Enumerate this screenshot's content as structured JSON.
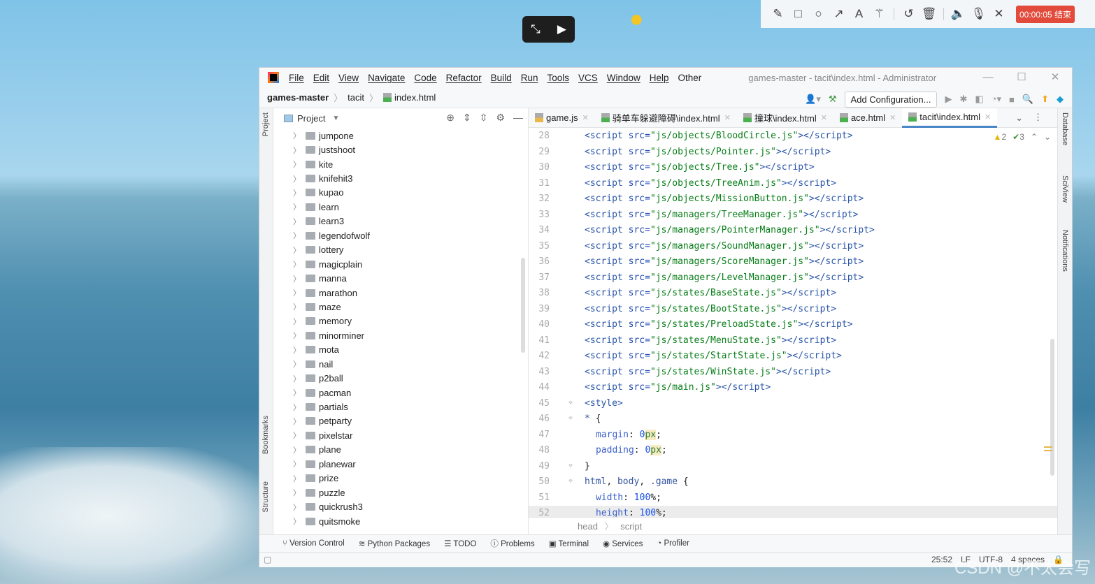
{
  "recorder": {
    "time": "00:00:05 结束",
    "tools": [
      "pencil",
      "rectangle",
      "circle",
      "arrow",
      "text",
      "magic-wand",
      "undo",
      "delete",
      "speaker",
      "microphone",
      "close"
    ]
  },
  "window": {
    "title": "games-master - tacit\\index.html - Administrator",
    "menu": [
      "File",
      "Edit",
      "View",
      "Navigate",
      "Code",
      "Refactor",
      "Build",
      "Run",
      "Tools",
      "VCS",
      "Window",
      "Help",
      "Other"
    ]
  },
  "breadcrumb": {
    "project": "games-master",
    "folder": "tacit",
    "file": "index.html"
  },
  "toolbar": {
    "add_config": "Add Configuration..."
  },
  "left_strip": {
    "project": "Project",
    "bookmarks": "Bookmarks",
    "structure": "Structure"
  },
  "right_strip": {
    "database": "Database",
    "sciview": "SciView",
    "notifications": "Notifications"
  },
  "project": {
    "title": "Project",
    "items": [
      "jumpone",
      "justshoot",
      "kite",
      "knifehit3",
      "kupao",
      "learn",
      "learn3",
      "legendofwolf",
      "lottery",
      "magicplain",
      "manna",
      "marathon",
      "maze",
      "memory",
      "minorminer",
      "mota",
      "nail",
      "p2ball",
      "pacman",
      "partials",
      "petparty",
      "pixelstar",
      "plane",
      "planewar",
      "prize",
      "puzzle",
      "quickrush3",
      "quitsmoke"
    ]
  },
  "tabs": [
    {
      "label": "game.js",
      "type": "js"
    },
    {
      "label": "骑单车躲避障碍\\index.html",
      "type": "html"
    },
    {
      "label": "撞球\\index.html",
      "type": "html"
    },
    {
      "label": "ace.html",
      "type": "html"
    },
    {
      "label": "tacit\\index.html",
      "type": "html",
      "active": true
    }
  ],
  "inspections": {
    "warnings": "2",
    "weak": "3"
  },
  "code": [
    {
      "n": "28",
      "src": "js/objects/BloodCircle.js"
    },
    {
      "n": "29",
      "src": "js/objects/Pointer.js"
    },
    {
      "n": "30",
      "src": "js/objects/Tree.js"
    },
    {
      "n": "31",
      "src": "js/objects/TreeAnim.js"
    },
    {
      "n": "32",
      "src": "js/objects/MissionButton.js"
    },
    {
      "n": "33",
      "src": "js/managers/TreeManager.js"
    },
    {
      "n": "34",
      "src": "js/managers/PointerManager.js"
    },
    {
      "n": "35",
      "src": "js/managers/SoundManager.js"
    },
    {
      "n": "36",
      "src": "js/managers/ScoreManager.js"
    },
    {
      "n": "37",
      "src": "js/managers/LevelManager.js"
    },
    {
      "n": "38",
      "src": "js/states/BaseState.js"
    },
    {
      "n": "39",
      "src": "js/states/BootState.js"
    },
    {
      "n": "40",
      "src": "js/states/PreloadState.js"
    },
    {
      "n": "41",
      "src": "js/states/MenuState.js"
    },
    {
      "n": "42",
      "src": "js/states/StartState.js"
    },
    {
      "n": "43",
      "src": "js/states/WinState.js"
    },
    {
      "n": "44",
      "src": "js/main.js"
    },
    {
      "n": "45",
      "tokens": [
        [
          "tag",
          "<style>"
        ]
      ]
    },
    {
      "n": "46",
      "tokens": [
        [
          "sel",
          "* "
        ],
        [
          "txt",
          "{"
        ]
      ]
    },
    {
      "n": "47",
      "tokens": [
        [
          "prop",
          "margin"
        ],
        [
          "txt",
          ": "
        ],
        [
          "num",
          "0"
        ],
        [
          "unit",
          "px"
        ],
        [
          "txt",
          ";"
        ]
      ]
    },
    {
      "n": "48",
      "tokens": [
        [
          "prop",
          "padding"
        ],
        [
          "txt",
          ": "
        ],
        [
          "num",
          "0"
        ],
        [
          "unit",
          "px"
        ],
        [
          "txt",
          ";"
        ]
      ]
    },
    {
      "n": "49",
      "tokens": [
        [
          "txt",
          "}"
        ]
      ]
    },
    {
      "n": "50",
      "tokens": [
        [
          "sel",
          "html"
        ],
        [
          "txt",
          ", "
        ],
        [
          "sel",
          "body"
        ],
        [
          "txt",
          ", "
        ],
        [
          "sel",
          ".game "
        ],
        [
          "txt",
          "{"
        ]
      ]
    },
    {
      "n": "51",
      "tokens": [
        [
          "prop",
          "width"
        ],
        [
          "txt",
          ": "
        ],
        [
          "num",
          "100"
        ],
        [
          "txt",
          "%;"
        ]
      ]
    },
    {
      "n": "52",
      "tokens": [
        [
          "prop",
          "height"
        ],
        [
          "txt",
          ": "
        ],
        [
          "num",
          "100"
        ],
        [
          "txt",
          "%;"
        ]
      ],
      "current": true
    }
  ],
  "editor_breadcrumb": [
    "head",
    "script"
  ],
  "tool_windows": [
    "Version Control",
    "Python Packages",
    "TODO",
    "Problems",
    "Terminal",
    "Services",
    "Profiler"
  ],
  "status": {
    "position": "25:52",
    "line_ending": "LF",
    "encoding": "UTF-8",
    "indent": "4 spaces"
  },
  "watermark": "CSDN @不太会写"
}
